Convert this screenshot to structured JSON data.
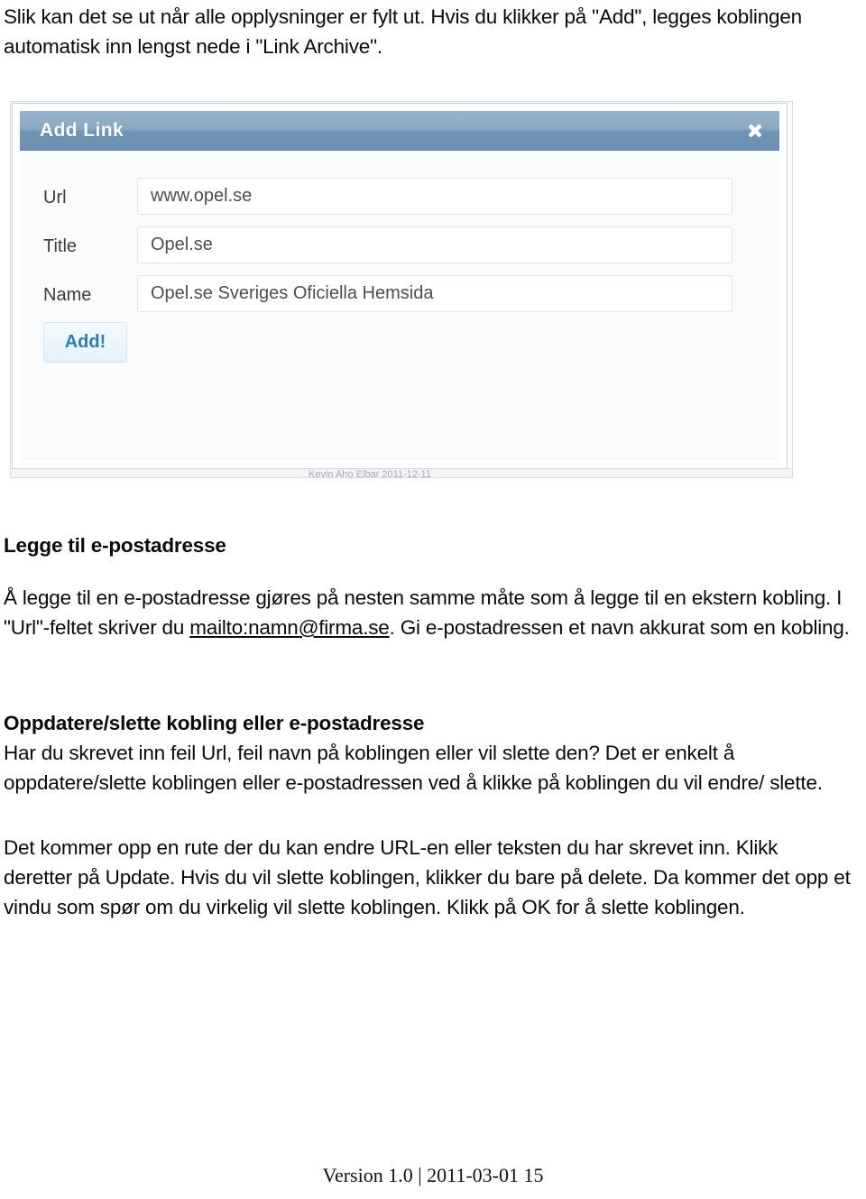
{
  "intro": {
    "text": "Slik kan det se ut når alle opplysninger er fylt ut. Hvis du klikker på \"Add\", legges koblingen automatisk inn lengst nede i \"Link Archive\"."
  },
  "figure": {
    "modal": {
      "title": "Add Link",
      "close_icon": "close-icon",
      "fields": [
        {
          "label": "Url",
          "value": "www.opel.se"
        },
        {
          "label": "Title",
          "value": "Opel.se"
        },
        {
          "label": "Name",
          "value": "Opel.se Sveriges Oficiella Hemsida"
        }
      ],
      "submit_label": "Add!"
    },
    "backdrop_bottom_text": "Kevin Aho Elbar 2011-12-11",
    "colors": {
      "titlebar_top": "#98b4cb",
      "titlebar_bottom": "#6d91b2",
      "submit_text": "#2f7eb3",
      "submit_bg": "#e9f4fc",
      "field_border": "#dfe4e9"
    }
  },
  "sections": {
    "email": {
      "heading": "Legge til e-postadresse",
      "body_before_link": "Å legge til en e-postadresse gjøres på nesten samme måte som å legge til en ekstern kobling. I \"Url\"-feltet skriver du ",
      "link": "mailto:namn@firma.se",
      "body_after_link": ". Gi e-postadressen et navn akkurat som en kobling."
    },
    "update": {
      "heading": "Oppdatere/slette kobling eller e-postadresse",
      "body": "Har du skrevet inn feil Url, feil navn på koblingen eller vil slette den? Det er enkelt å oppdatere/slette koblingen eller e-postadressen ved å klikke på koblingen du vil endre/ slette."
    },
    "dialog": {
      "body": "Det kommer opp en rute der du kan endre URL-en eller teksten du har skrevet inn. Klikk deretter på Update. Hvis du vil slette koblingen, klikker du bare på delete. Da kommer det opp et vindu som spør om du virkelig vil slette koblingen. Klikk på OK for å slette koblingen."
    }
  },
  "footer": {
    "text": "Version 1.0 | 2011-03-01 15"
  }
}
